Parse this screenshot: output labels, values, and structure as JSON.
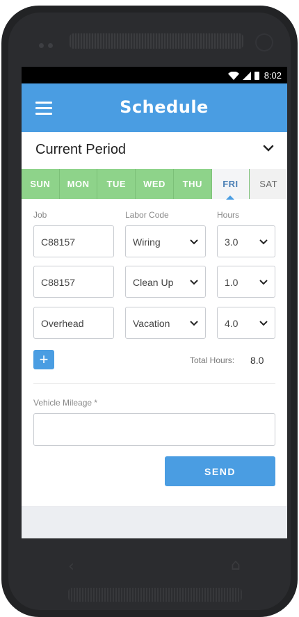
{
  "status_bar": {
    "time": "8:02"
  },
  "app_bar": {
    "title": "Schedule"
  },
  "period": {
    "label": "Current Period"
  },
  "days": [
    {
      "label": "SUN"
    },
    {
      "label": "MON"
    },
    {
      "label": "TUE"
    },
    {
      "label": "WED"
    },
    {
      "label": "THU"
    },
    {
      "label": "FRI",
      "selected": true
    },
    {
      "label": "SAT"
    }
  ],
  "columns": {
    "job": "Job",
    "labor_code": "Labor Code",
    "hours": "Hours"
  },
  "rows": [
    {
      "job": "C88157",
      "labor_code": "Wiring",
      "hours": "3.0"
    },
    {
      "job": "C88157",
      "labor_code": "Clean Up",
      "hours": "1.0"
    },
    {
      "job": "Overhead",
      "labor_code": "Vacation",
      "hours": "4.0"
    }
  ],
  "add_button": {
    "label": "+"
  },
  "totals": {
    "label": "Total Hours:",
    "value": "8.0"
  },
  "mileage": {
    "label": "Vehicle Mileage *",
    "value": ""
  },
  "send_button": {
    "label": "SEND"
  },
  "colors": {
    "accent": "#4a9de2",
    "day_green": "#8ed38a",
    "selected_day_text": "#4a7fb5"
  },
  "icons": {
    "menu": "hamburger-menu-icon",
    "dropdown": "chevron-down-icon",
    "wifi": "wifi-icon",
    "signal": "signal-icon",
    "battery": "battery-icon",
    "back": "back-icon",
    "home": "home-icon"
  }
}
